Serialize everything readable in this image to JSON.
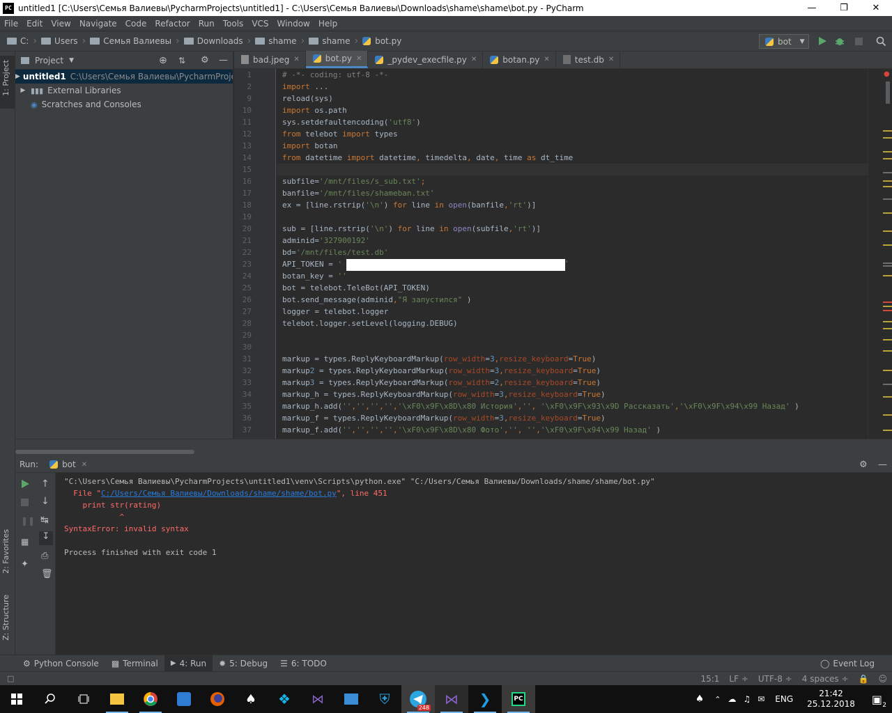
{
  "window": {
    "title": "untitled1 [C:\\Users\\Семья Валиевы\\PycharmProjects\\untitled1] - C:\\Users\\Семья Валиевы\\Downloads\\shame\\shame\\bot.py - PyCharm",
    "app_badge": "PC"
  },
  "menu": [
    "File",
    "Edit",
    "View",
    "Navigate",
    "Code",
    "Refactor",
    "Run",
    "Tools",
    "VCS",
    "Window",
    "Help"
  ],
  "breadcrumbs": [
    "C:",
    "Users",
    "Семья Валиевы",
    "Downloads",
    "shame",
    "shame",
    "bot.py"
  ],
  "run_config": "bot",
  "side_tabs": {
    "project": "1: Project",
    "favorites": "2: Favorites",
    "structure": "Z: Structure"
  },
  "project": {
    "header": "Project",
    "tree": [
      {
        "label": "untitled1",
        "path": "C:\\Users\\Семья Валиевы\\PycharmProjec"
      },
      {
        "label": "External Libraries"
      },
      {
        "label": "Scratches and Consoles"
      }
    ]
  },
  "editor_tabs": [
    "bad.jpeg",
    "bot.py",
    "_pydev_execfile.py",
    "botan.py",
    "test.db"
  ],
  "editor": {
    "line_numbers": [
      "1",
      "2",
      "9",
      "10",
      "11",
      "12",
      "13",
      "14",
      "15",
      "16",
      "17",
      "18",
      "19",
      "20",
      "21",
      "22",
      "23",
      "24",
      "25",
      "26",
      "27",
      "28",
      "29",
      "30",
      "31",
      "32",
      "33",
      "34",
      "35",
      "36",
      "37"
    ],
    "lines": [
      "# -*- coding: utf-8 -*-",
      "import ...",
      "reload(sys)",
      "import os.path",
      "sys.setdefaultencoding('utf8')",
      "from telebot import types",
      "import botan",
      "from datetime import datetime, timedelta, date, time as dt_time",
      "",
      "subfile='/mnt/files/s_sub.txt';",
      "banfile='/mnt/files/shameban.txt'",
      "ex = [line.rstrip('\\n') for line in open(banfile,'rt')]",
      "",
      "sub = [line.rstrip('\\n') for line in open(subfile,'rt')]",
      "adminid='327900192'",
      "bd='/mnt/files/test.db'",
      "API_TOKEN = '",
      "botan_key = ''",
      "bot = telebot.TeleBot(API_TOKEN)",
      "bot.send_message(adminid,\"Я запустился\" )",
      "logger = telebot.logger",
      "telebot.logger.setLevel(logging.DEBUG)",
      "",
      "",
      "markup = types.ReplyKeyboardMarkup(row_width=3,resize_keyboard=True)",
      "markup2 = types.ReplyKeyboardMarkup(row_width=3,resize_keyboard=True)",
      "markup3 = types.ReplyKeyboardMarkup(row_width=2,resize_keyboard=True)",
      "markup_h = types.ReplyKeyboardMarkup(row_width=3,resize_keyboard=True)",
      "markup_h.add('','','','','\\xF0\\x9F\\x8D\\x80 История','', '\\xF0\\x9F\\x93\\x9D Рассказать','\\xF0\\x9F\\x94\\x99 Назад' )",
      "markup_f = types.ReplyKeyboardMarkup(row_width=3,resize_keyboard=True)",
      "markup_f.add('','','','','\\xF0\\x9F\\x8D\\x80 Фото','', '','\\xF0\\x9F\\x94\\x99 Назад' )"
    ]
  },
  "run": {
    "label": "Run:",
    "tab": "bot",
    "console": [
      "\"C:\\Users\\Семья Валиевы\\PycharmProjects\\untitled1\\venv\\Scripts\\python.exe\" \"C:/Users/Семья Валиевы/Downloads/shame/shame/bot.py\"",
      "  File \"C:/Users/Семья Валиевы/Downloads/shame/shame/bot.py\", line 451",
      "    print str(rating)",
      "            ^",
      "SyntaxError: invalid syntax",
      "",
      "Process finished with exit code 1"
    ]
  },
  "bottom_tabs": [
    "Python Console",
    "Terminal",
    "4: Run",
    "5: Debug",
    "6: TODO"
  ],
  "event_log": "Event Log",
  "status": {
    "position": "15:1",
    "line_sep": "LF ÷",
    "encoding": "UTF-8 ÷",
    "indent": "4 spaces ÷"
  },
  "taskbar": {
    "time": "21:42",
    "date": "25.12.2018",
    "lang": "ENG",
    "telegram_badge": "248",
    "notifications": "2"
  },
  "colors": {
    "keyword": "#cc7832",
    "string": "#6a8759",
    "param": "#aa4926",
    "comment": "#808080",
    "error": "#ff6b68",
    "link": "#287bde"
  }
}
